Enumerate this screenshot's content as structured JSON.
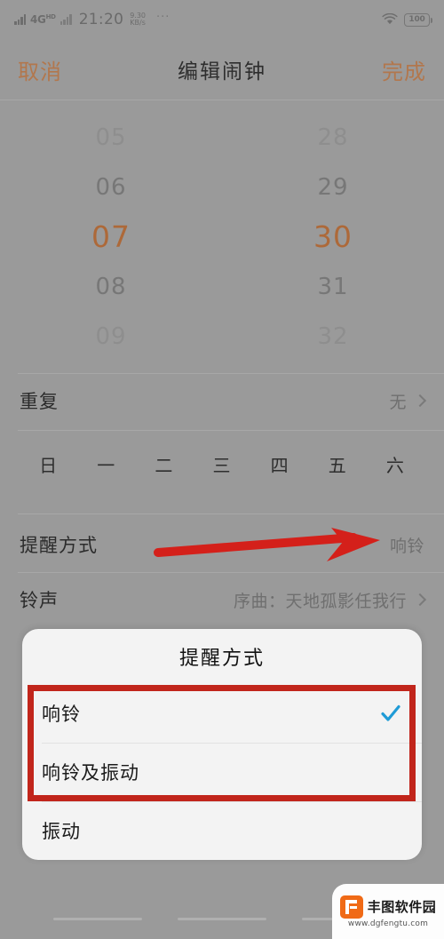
{
  "status_bar": {
    "network_label": "4G",
    "network_sup": "HD",
    "time": "21:20",
    "speed_value": "9.30",
    "speed_unit": "KB/s",
    "overflow_dots": "···",
    "wifi_icon": "wifi-icon",
    "battery_level": "100"
  },
  "navbar": {
    "cancel": "取消",
    "title": "编辑闹钟",
    "done": "完成",
    "accent_color": "#b2774d"
  },
  "time_picker": {
    "hours": [
      "05",
      "06",
      "07",
      "08",
      "09"
    ],
    "minutes": [
      "28",
      "29",
      "30",
      "31",
      "32"
    ],
    "selected_hour": "07",
    "selected_minute": "30",
    "selected_color": "#ad6939"
  },
  "settings": {
    "repeat": {
      "label": "重复",
      "value": "无",
      "chevron_icon": "chevron-right-icon"
    },
    "weekdays": [
      "日",
      "一",
      "二",
      "三",
      "四",
      "五",
      "六"
    ],
    "reminder_mode": {
      "label": "提醒方式",
      "value": "响铃"
    },
    "ringtone": {
      "label": "铃声",
      "value": "序曲：天地孤影任我行",
      "chevron_icon": "chevron-right-icon"
    }
  },
  "annotations": {
    "arrow_color": "#d4201a",
    "highlight_box_color": "#c1251b"
  },
  "dialog": {
    "title": "提醒方式",
    "options": [
      {
        "label": "响铃",
        "selected": true
      },
      {
        "label": "响铃及振动",
        "selected": false
      },
      {
        "label": "振动",
        "selected": false
      }
    ],
    "check_icon": "check-icon",
    "check_color": "#1f9bd6"
  },
  "watermark": {
    "name": "丰图软件园",
    "url": "www.dgfengtu.com",
    "logo_color": "#f06a16"
  }
}
